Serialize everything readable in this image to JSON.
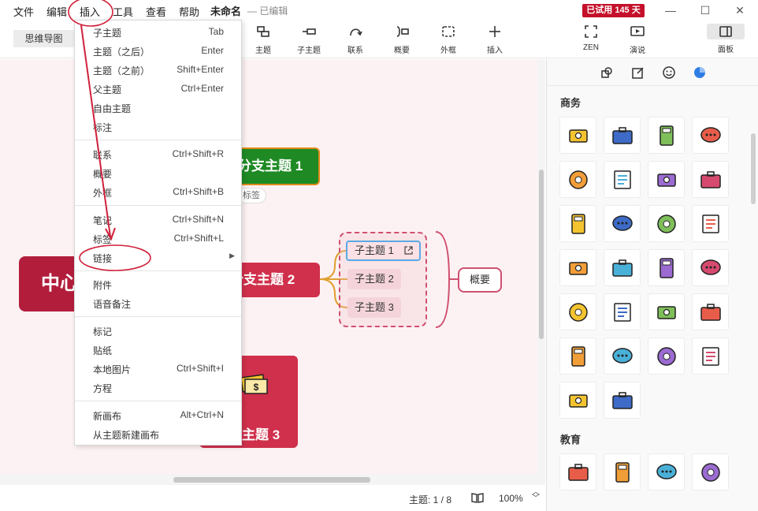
{
  "menubar": {
    "items": [
      "文件",
      "编辑",
      "插入",
      "工具",
      "查看",
      "帮助"
    ],
    "doc_title": "未命名",
    "doc_status": "— 已编辑",
    "trial_badge": "已试用 145 天",
    "window": {
      "minimize": "—",
      "maximize": "☐",
      "close": "✕"
    }
  },
  "toolbar": {
    "mode_label": "思维导图",
    "tools": [
      "主题",
      "子主题",
      "联系",
      "概要",
      "外框",
      "插入"
    ],
    "right_tools": [
      "ZEN",
      "演说"
    ],
    "panel_label": "面板"
  },
  "insert_menu": {
    "items": [
      {
        "label": "子主题",
        "shortcut": "Tab"
      },
      {
        "label": "主题（之后）",
        "shortcut": "Enter"
      },
      {
        "label": "主题（之前）",
        "shortcut": "Shift+Enter"
      },
      {
        "label": "父主题",
        "shortcut": "Ctrl+Enter"
      },
      {
        "label": "自由主题",
        "shortcut": ""
      },
      {
        "label": "标注",
        "shortcut": ""
      },
      {
        "label": "联系",
        "shortcut": "Ctrl+Shift+R"
      },
      {
        "label": "概要",
        "shortcut": ""
      },
      {
        "label": "外框",
        "shortcut": "Ctrl+Shift+B"
      },
      {
        "label": "笔记",
        "shortcut": "Ctrl+Shift+N"
      },
      {
        "label": "标签",
        "shortcut": "Ctrl+Shift+L"
      },
      {
        "label": "链接",
        "shortcut": ""
      },
      {
        "label": "附件",
        "shortcut": ""
      },
      {
        "label": "语音备注",
        "shortcut": ""
      },
      {
        "label": "标记",
        "shortcut": ""
      },
      {
        "label": "贴纸",
        "shortcut": ""
      },
      {
        "label": "本地图片",
        "shortcut": "Ctrl+Shift+I"
      },
      {
        "label": "方程",
        "shortcut": ""
      },
      {
        "label": "新画布",
        "shortcut": "Alt+Ctrl+N"
      },
      {
        "label": "从主题新建画布",
        "shortcut": ""
      }
    ]
  },
  "mindmap": {
    "central": "中心",
    "branch1": "分支主题 1",
    "branch1_tag": "标签",
    "branch2": "分支主题 2",
    "branch3": "主题 3",
    "subtopics": [
      "子主题 1",
      "子主题 2",
      "子主题 3"
    ],
    "summary": "概要"
  },
  "status": {
    "topics": "主题: 1 / 8",
    "zoom": "100%"
  },
  "right_panel": {
    "sections": [
      "商务",
      "教育"
    ],
    "business_stickers": [
      "money-sticker-icon",
      "briefcase-sticker-icon",
      "calculator-sticker-icon",
      "chat-sticker-icon",
      "coffee-sticker-icon",
      "contact-book-sticker-icon",
      "support-agent-sticker-icon",
      "envelope-sticker-icon",
      "document-search-sticker-icon",
      "folder-sticker-icon",
      "globe-pin-sticker-icon",
      "mailbox-sticker-icon",
      "vinyl-sticker-icon",
      "newspaper-sticker-icon",
      "book-sticker-icon",
      "presentation-sticker-icon",
      "printer-sticker-icon",
      "magnifier-chart-sticker-icon",
      "target-sticker-icon",
      "team-sticker-icon",
      "clock-sticker-icon",
      "checklist-sticker-icon",
      "bar-chart-sticker-icon",
      "coins-sticker-icon",
      "microphone-sticker-icon",
      "id-card-sticker-icon"
    ],
    "education_stickers": [
      "atom-sticker-icon",
      "scale-sticker-icon",
      "flask-sticker-icon",
      "pendulum-sticker-icon"
    ]
  },
  "colors": {
    "central": "#b21d3c",
    "branch1": "#1f8a24",
    "branch2": "#d0304c",
    "trial": "#c4102a",
    "annotation": "#d0203a"
  }
}
